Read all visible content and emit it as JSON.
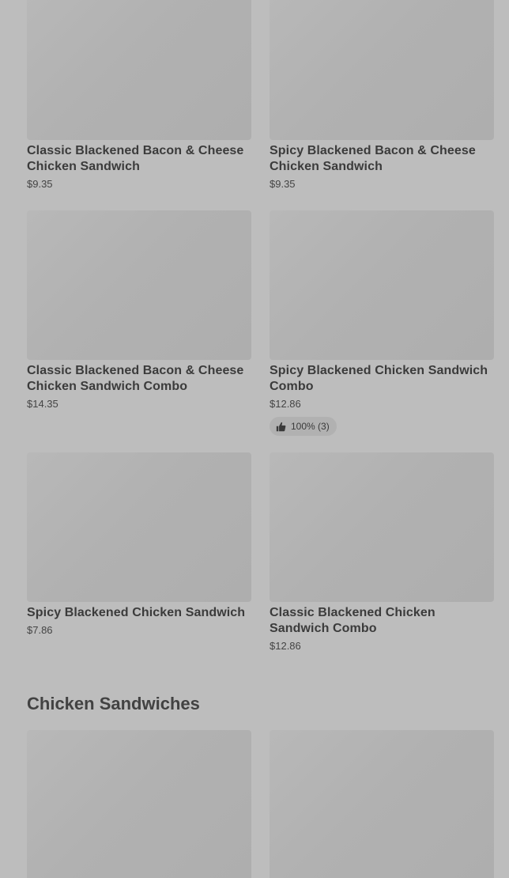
{
  "menu_items": [
    {
      "name": "Classic Blackened Bacon & Cheese Chicken Sandwich",
      "price": "$9.35"
    },
    {
      "name": "Spicy Blackened Bacon & Cheese Chicken Sandwich",
      "price": "$9.35"
    },
    {
      "name": "Classic Blackened Bacon & Cheese Chicken Sandwich Combo",
      "price": "$14.35"
    },
    {
      "name": "Spicy Blackened Chicken Sandwich Combo",
      "price": "$12.86",
      "rating": "100% (3)"
    },
    {
      "name": "Spicy Blackened Chicken Sandwich",
      "price": "$7.86"
    },
    {
      "name": "Classic Blackened Chicken Sandwich Combo",
      "price": "$12.86"
    }
  ],
  "section": {
    "title": "Chicken Sandwiches"
  },
  "icons": {
    "rating": "thumbs-up-icon"
  },
  "colors": {
    "background": "#bdbdbd",
    "image_placeholder": "#b1b1b1"
  }
}
